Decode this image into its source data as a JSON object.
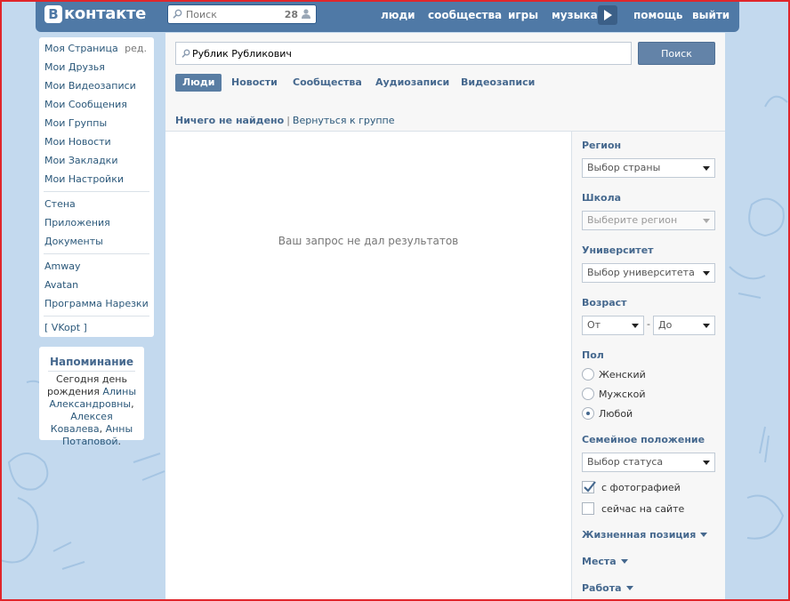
{
  "header": {
    "logo_letter": "В",
    "logo_text": "контакте",
    "search_placeholder": "Поиск",
    "search_count": "28",
    "nav": [
      "люди",
      "сообщества",
      "игры",
      "музыка",
      "помощь",
      "выйти"
    ]
  },
  "sidebar": {
    "edit_label": "ред.",
    "items": [
      "Моя Страница",
      "Мои Друзья",
      "Мои Видеозаписи",
      "Мои Сообщения",
      "Мои Группы",
      "Мои Новости",
      "Мои Закладки",
      "Мои Настройки"
    ],
    "apps": [
      "Стена",
      "Приложения",
      "Документы"
    ],
    "groups": [
      "Amway",
      "Avatan",
      "Программа Нарезки"
    ],
    "extra": "[ VKopt ]"
  },
  "reminder": {
    "title": "Напоминание",
    "text_prefix": "Сегодня день рождения",
    "person1": "Алины Александровны",
    "person2": "Алексея Ковалева",
    "person3": "Анны Потаповой",
    "sep1": ",",
    "sep2": ",",
    "end": "."
  },
  "main": {
    "search_value": "Рублик Рубликович",
    "search_button": "Поиск",
    "tabs": [
      "Люди",
      "Новости",
      "Сообщества",
      "Аудиозаписи",
      "Видеозаписи"
    ],
    "active_tab": "Люди",
    "status_not_found": "Ничего не найдено",
    "status_sep": "|",
    "status_back": "Вернуться к группе",
    "no_results": "Ваш запрос не дал результатов"
  },
  "filters": {
    "region_label": "Регион",
    "region_value": "Выбор страны",
    "school_label": "Школа",
    "school_value": "Выберите регион",
    "university_label": "Университет",
    "university_value": "Выбор университета",
    "age_label": "Возраст",
    "age_from": "От",
    "age_sep": "-",
    "age_to": "До",
    "sex_label": "Пол",
    "sex_options": [
      "Женский",
      "Мужской",
      "Любой"
    ],
    "sex_selected": "Любой",
    "marital_label": "Семейное положение",
    "marital_value": "Выбор статуса",
    "with_photo": "с фотографией",
    "with_photo_checked": true,
    "online_now": "сейчас на сайте",
    "online_now_checked": false,
    "life_position": "Жизненная позиция",
    "places": "Места",
    "work": "Работа"
  },
  "colors": {
    "header_bg": "#4f79a6",
    "link": "#2b587a",
    "heading": "#45688e",
    "page_bg": "#c3d9ee",
    "frame": "#e0262b"
  }
}
